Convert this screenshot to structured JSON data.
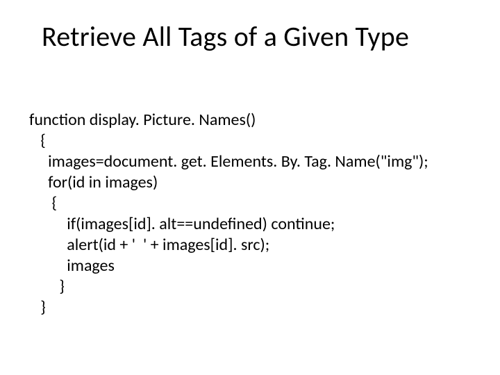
{
  "title": "Retrieve All Tags of a Given Type",
  "code": {
    "l1": "function display. Picture. Names()",
    "l2": "   {",
    "l3a": "     images=document. ",
    "l3b": "get. Elements. By. Tag. Name",
    "l3c": "(\"img\");",
    "l4": "     for(id in images)",
    "l5": "      {",
    "l6": "          if(images[id]. alt==undefined) continue;",
    "l7": "          alert(id + '  ' + images[id]. src);",
    "l8": "          images",
    "l9": "        }",
    "l10": "   }"
  }
}
